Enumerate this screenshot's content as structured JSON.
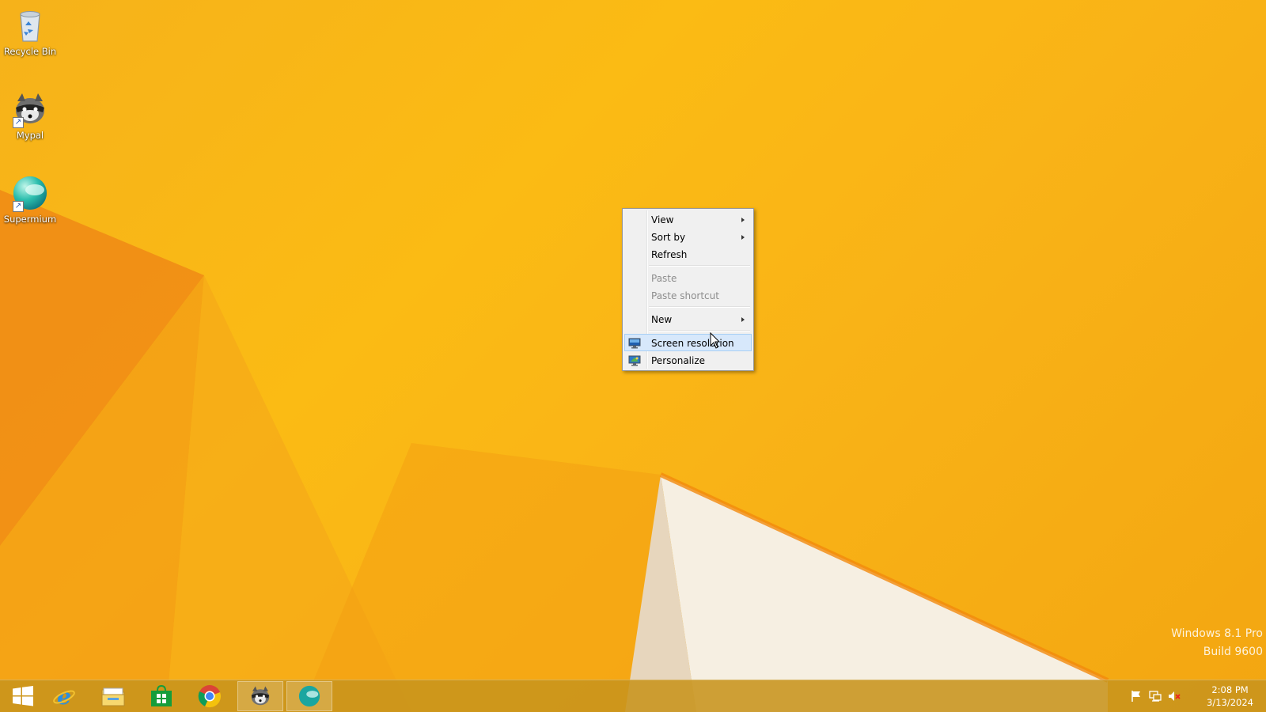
{
  "desktop_icons": [
    {
      "label": "Recycle Bin",
      "icon": "recycle-bin-icon"
    },
    {
      "label": "Mypal",
      "icon": "raccoon-icon"
    },
    {
      "label": "Supermium",
      "icon": "supermium-icon"
    }
  ],
  "context_menu": {
    "items": [
      {
        "label": "View",
        "submenu": true,
        "enabled": true
      },
      {
        "label": "Sort by",
        "submenu": true,
        "enabled": true
      },
      {
        "label": "Refresh",
        "enabled": true
      },
      {
        "label": "Paste",
        "enabled": false
      },
      {
        "label": "Paste shortcut",
        "enabled": false
      },
      {
        "label": "New",
        "submenu": true,
        "enabled": true
      },
      {
        "label": "Screen resolution",
        "enabled": true,
        "highlighted": true,
        "icon": "monitor-icon"
      },
      {
        "label": "Personalize",
        "enabled": true,
        "icon": "personalize-icon"
      }
    ]
  },
  "watermark": {
    "line1": "Windows 8.1 Pro",
    "line2": "Build 9600"
  },
  "taskbar": {
    "buttons": [
      {
        "name": "start",
        "icon": "windows-logo-icon"
      },
      {
        "name": "internet-explorer",
        "icon": "internet-explorer-icon"
      },
      {
        "name": "file-explorer",
        "icon": "folder-icon"
      },
      {
        "name": "store",
        "icon": "store-icon"
      },
      {
        "name": "chrome",
        "icon": "chrome-icon"
      },
      {
        "name": "mypal",
        "icon": "raccoon-icon",
        "running": true
      },
      {
        "name": "supermium",
        "icon": "supermium-icon",
        "running": true
      }
    ],
    "tray": {
      "icons": [
        "flag-icon",
        "network-icon",
        "volume-muted-icon"
      ],
      "time": "2:08 PM",
      "date": "3/13/2024"
    }
  },
  "colors": {
    "wallpaper": "#f9b817",
    "menu_bg": "#f0f0f0",
    "menu_highlight": "#d7e8fb",
    "taskbar": "#c8941c"
  }
}
